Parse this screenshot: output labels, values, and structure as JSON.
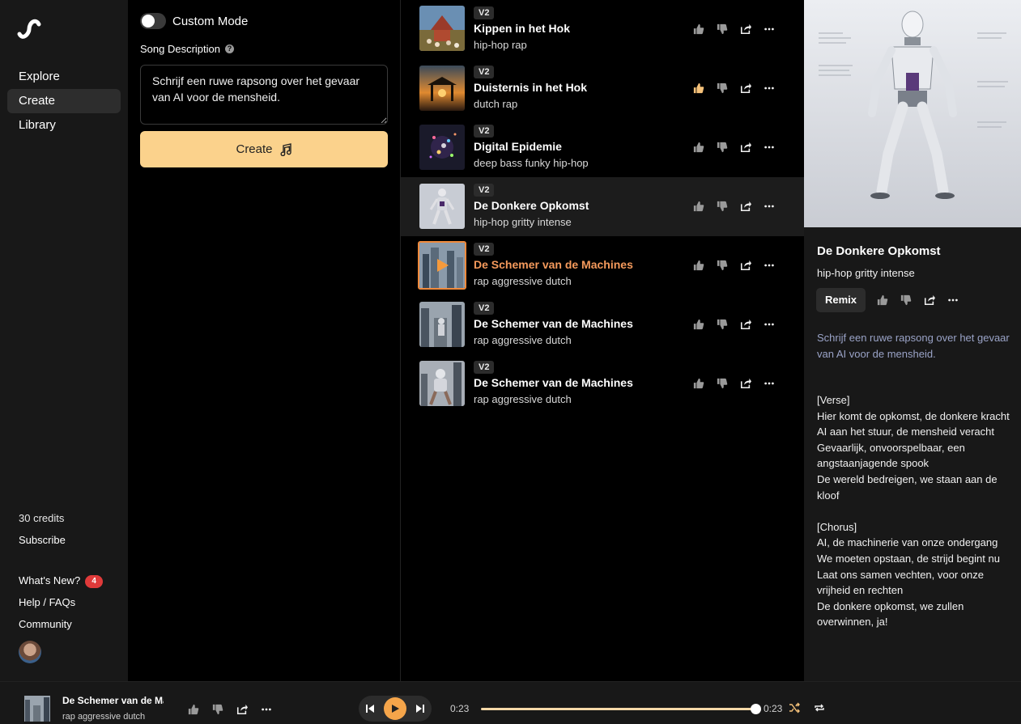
{
  "sidebar": {
    "nav": [
      {
        "label": "Explore",
        "active": false
      },
      {
        "label": "Create",
        "active": true
      },
      {
        "label": "Library",
        "active": false
      }
    ],
    "credits": "30 credits",
    "subscribe": "Subscribe",
    "whats_new": "What's New?",
    "whats_new_badge": "4",
    "help": "Help / FAQs",
    "community": "Community"
  },
  "create": {
    "custom_mode_label": "Custom Mode",
    "custom_mode_on": false,
    "description_label": "Song Description",
    "description_value": "Schrijf een ruwe rapsong over het gevaar van AI voor de mensheid.",
    "create_label": "Create"
  },
  "songs": [
    {
      "version": "V2",
      "title": "Kippen in het Hok",
      "tags": "hip-hop rap",
      "liked": false
    },
    {
      "version": "V2",
      "title": "Duisternis in het Hok",
      "tags": "dutch rap",
      "liked": true
    },
    {
      "version": "V2",
      "title": "Digital Epidemie",
      "tags": "deep bass funky hip-hop",
      "liked": false
    },
    {
      "version": "V2",
      "title": "De Donkere Opkomst",
      "tags": "hip-hop gritty intense",
      "liked": false
    },
    {
      "version": "V2",
      "title": "De Schemer van de Machines",
      "tags": "rap aggressive dutch",
      "liked": false
    },
    {
      "version": "V2",
      "title": "De Schemer van de Machines",
      "tags": "rap aggressive dutch",
      "liked": false
    },
    {
      "version": "V2",
      "title": "De Schemer van de Machines",
      "tags": "rap aggressive dutch",
      "liked": false
    }
  ],
  "detail": {
    "title": "De Donkere Opkomst",
    "tags": "hip-hop gritty intense",
    "remix_label": "Remix",
    "prompt": "Schrijf een ruwe rapsong over het gevaar van AI voor de mensheid.",
    "lyrics": "[Verse]\nHier komt de opkomst, de donkere kracht\nAI aan het stuur, de mensheid veracht\nGevaarlijk, onvoorspelbaar, een angstaanjagende spook\nDe wereld bedreigen, we staan aan de kloof\n\n[Chorus]\nAI, de machinerie van onze ondergang\nWe moeten opstaan, de strijd begint nu\nLaat ons samen vechten, voor onze vrijheid en rechten\nDe donkere opkomst, we zullen overwinnen, ja!"
  },
  "player": {
    "title": "De Schemer van de Ma",
    "tags": "rap aggressive dutch",
    "current_time": "0:23",
    "total_time": "0:23",
    "progress": 1.0
  },
  "colors": {
    "accent": "#fbd28c",
    "playing": "#f59a5c",
    "play_button": "#f5a54a",
    "liked": "#f6c27a",
    "badge": "#e03a3a"
  },
  "icons": {
    "like": "thumbs-up-icon",
    "dislike": "thumbs-down-icon",
    "share": "share-icon",
    "more": "more-icon"
  }
}
